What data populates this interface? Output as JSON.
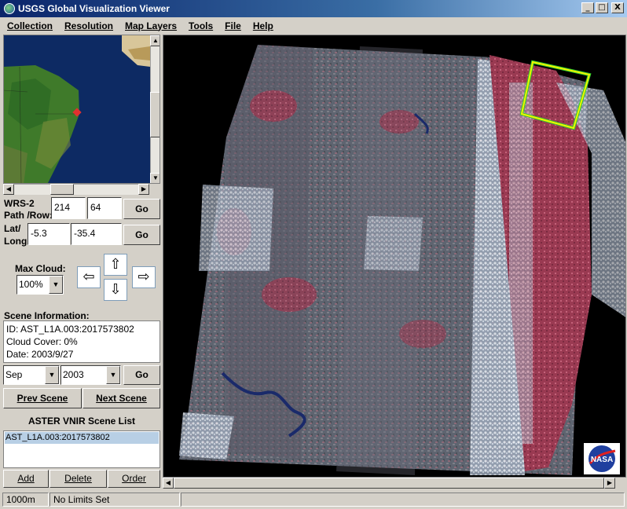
{
  "window": {
    "title": "USGS Global Visualization Viewer",
    "controls": [
      "_",
      "□",
      "X"
    ]
  },
  "menu": [
    "Collection",
    "Resolution",
    "Map Layers",
    "Tools",
    "File",
    "Help"
  ],
  "wrs": {
    "label_line1": "WRS-2",
    "label_line2": "Path /Row:",
    "path": "214",
    "row": "64",
    "go": "Go"
  },
  "latlong": {
    "label_line1": "Lat/",
    "label_line2": "Long:",
    "lat": "-5.3",
    "long": "-35.4",
    "go": "Go"
  },
  "cloud": {
    "label": "Max Cloud:",
    "value": "100%"
  },
  "nav_arrows": {
    "up": "⇧",
    "left": "⇦",
    "right": "⇨",
    "down": "⇩"
  },
  "scene_info": {
    "header": "Scene Information:",
    "id": "ID: AST_L1A.003:2017573802",
    "cloud_cover": "Cloud Cover: 0%",
    "date": "Date: 2003/9/27"
  },
  "date_select": {
    "month": "Sep",
    "year": "2003",
    "go": "Go"
  },
  "scene_nav": {
    "prev": "Prev Scene",
    "next": "Next Scene"
  },
  "scene_list": {
    "title": "ASTER VNIR Scene List",
    "items": [
      "AST_L1A.003:2017573802"
    ]
  },
  "list_actions": {
    "add": "Add",
    "delete": "Delete",
    "order": "Order"
  },
  "status": {
    "resolution": "1000m",
    "limits": "No Limits Set"
  },
  "logo": {
    "text": "NASA"
  },
  "colors": {
    "titlebar": "#0a246a",
    "selection": "#b8cfe5",
    "scene_highlight": "#f2f200",
    "scene_outline": "#2fcf2f"
  }
}
